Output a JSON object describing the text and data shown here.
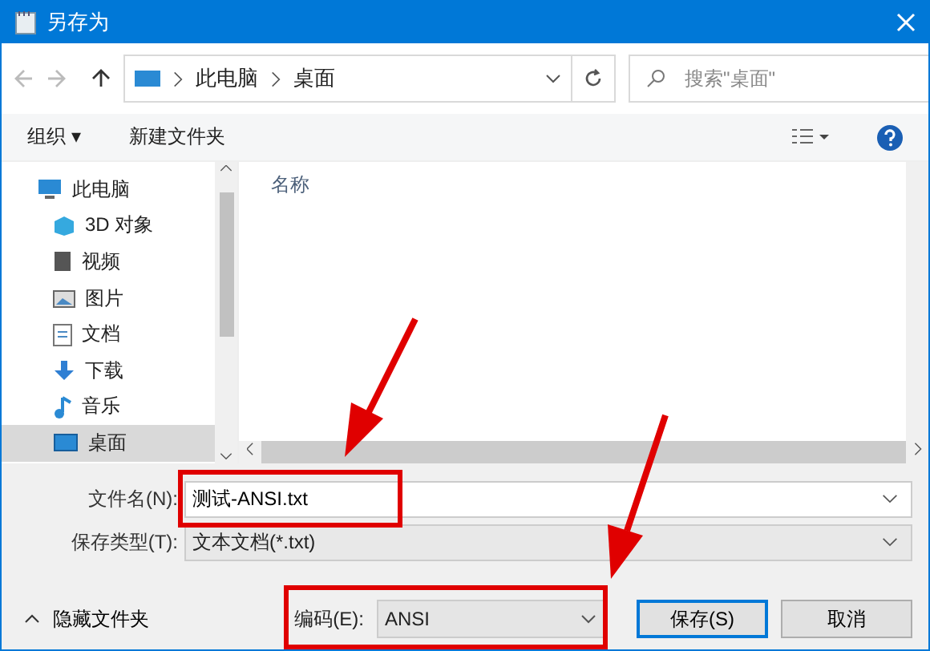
{
  "window": {
    "title": "另存为"
  },
  "address": {
    "crumbs": [
      "此电脑",
      "桌面"
    ]
  },
  "search": {
    "placeholder": "搜索\"桌面\""
  },
  "toolbar": {
    "organize": "组织 ▾",
    "new_folder": "新建文件夹"
  },
  "sidebar": {
    "items": [
      {
        "label": "此电脑",
        "kind": "pc",
        "selected": false,
        "children": [
          {
            "label": "3D 对象",
            "kind": "cube",
            "selected": false
          },
          {
            "label": "视频",
            "kind": "video",
            "selected": false
          },
          {
            "label": "图片",
            "kind": "picture",
            "selected": false
          },
          {
            "label": "文档",
            "kind": "doc",
            "selected": false
          },
          {
            "label": "下载",
            "kind": "download",
            "selected": false
          },
          {
            "label": "音乐",
            "kind": "music",
            "selected": false
          },
          {
            "label": "桌面",
            "kind": "desktop",
            "selected": true
          }
        ]
      }
    ]
  },
  "file_list": {
    "columns": [
      "名称"
    ]
  },
  "form": {
    "filename_label": "文件名(N):",
    "filename": "测试-ANSI.txt",
    "type_label": "保存类型(T):",
    "type": "文本文档(*.txt)",
    "encoding_label": "编码(E):",
    "encoding": "ANSI"
  },
  "hide_folders": "隐藏文件夹",
  "buttons": [
    {
      "label": "保存(S)",
      "primary": true
    },
    {
      "label": "取消",
      "primary": false
    }
  ]
}
